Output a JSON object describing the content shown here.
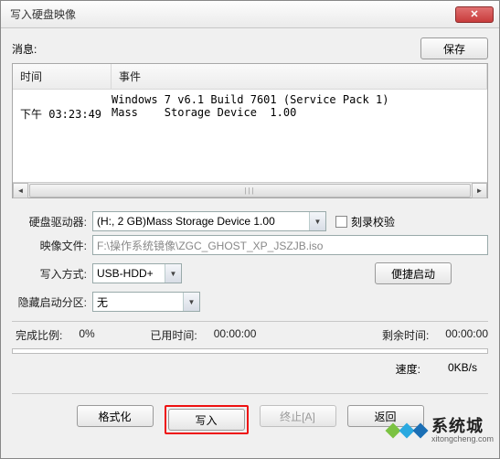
{
  "window": {
    "title": "写入硬盘映像"
  },
  "message_label": "消息:",
  "save_label": "保存",
  "log": {
    "columns": {
      "time": "时间",
      "event": "事件"
    },
    "rows": [
      {
        "time": "",
        "event": "Windows 7 v6.1 Build 7601 (Service Pack 1)"
      },
      {
        "time": "下午 03:23:49",
        "event": "Mass    Storage Device  1.00"
      }
    ]
  },
  "form": {
    "disk_label": "硬盘驱动器:",
    "disk_value": "(H:, 2 GB)Mass    Storage Device  1.00  ",
    "verify_label": "刻录校验",
    "image_label": "映像文件:",
    "image_value": "F:\\操作系统镜像\\ZGC_GHOST_XP_JSZJB.iso",
    "method_label": "写入方式:",
    "method_value": "USB-HDD+",
    "quick_boot_label": "便捷启动",
    "hide_label": "隐藏启动分区:",
    "hide_value": "无"
  },
  "stats": {
    "percent_label": "完成比例:",
    "percent_value": "0%",
    "elapsed_label": "已用时间:",
    "elapsed_value": "00:00:00",
    "remain_label": "剩余时间:",
    "remain_value": "00:00:00",
    "speed_label": "速度:",
    "speed_value": "0KB/s"
  },
  "buttons": {
    "format": "格式化",
    "write": "写入",
    "abort": "终止[A]",
    "back": "返回"
  },
  "watermark": {
    "cn": "系统城",
    "en": "xitongcheng.com"
  },
  "colors": {
    "highlight": "#e11",
    "wm1": "#7bc242",
    "wm2": "#2aa9e0",
    "wm3": "#1b6fb5"
  }
}
